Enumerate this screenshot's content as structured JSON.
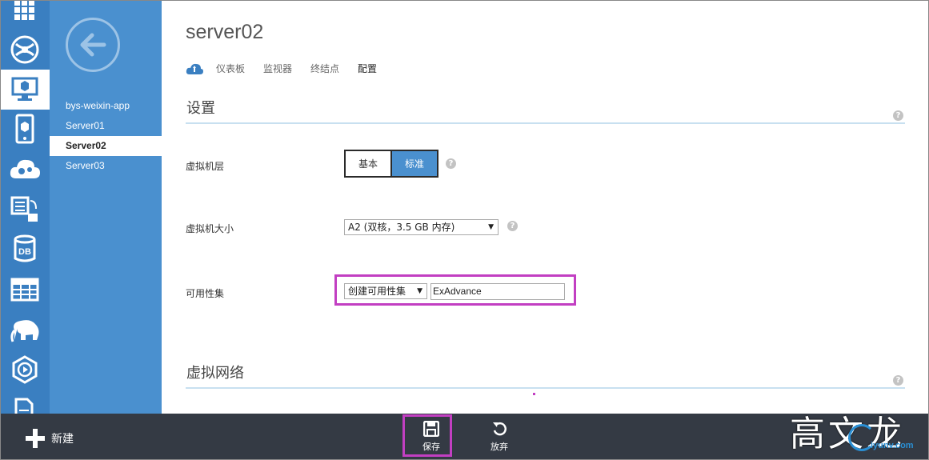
{
  "nav": {
    "items": [
      {
        "label": "bys-weixin-app",
        "active": false
      },
      {
        "label": "Server01",
        "active": false
      },
      {
        "label": "Server02",
        "active": true
      },
      {
        "label": "Server03",
        "active": false
      }
    ]
  },
  "rail": {
    "icons": [
      "grid-icon",
      "web-globe-icon",
      "virtual-machine-icon",
      "mobile-service-icon",
      "cloud-service-icon",
      "batch-icon",
      "database-icon",
      "storage-table-icon",
      "hdinsight-elephant-icon",
      "media-services-icon",
      "document-icon"
    ],
    "db_label": "DB"
  },
  "header": {
    "title": "server02",
    "tabs": [
      {
        "label": "仪表板",
        "active": false
      },
      {
        "label": "监视器",
        "active": false
      },
      {
        "label": "终结点",
        "active": false
      },
      {
        "label": "配置",
        "active": true
      }
    ]
  },
  "settings": {
    "section_title": "设置",
    "tier": {
      "label": "虚拟机层",
      "options": [
        "基本",
        "标准"
      ],
      "selected": "标准"
    },
    "size": {
      "label": "虚拟机大小",
      "value": "A2 (双核，3.5 GB 内存)"
    },
    "availability": {
      "label": "可用性集",
      "select_value": "创建可用性集",
      "input_value": "ExAdvance"
    }
  },
  "vnet": {
    "section_title": "虚拟网络"
  },
  "help_glyph": "?",
  "dropdown_glyph": "▼",
  "toolbar": {
    "new_label": "新建",
    "save_label": "保存",
    "discard_label": "放弃"
  },
  "watermark": {
    "text": "高文龙",
    "site": "iyunv.com"
  },
  "colors": {
    "rail": "#3a7fc1",
    "nav": "#4a90cf",
    "accent": "#4a90cf",
    "bottom_bar": "#343a44",
    "highlight": "#c23fc2"
  }
}
